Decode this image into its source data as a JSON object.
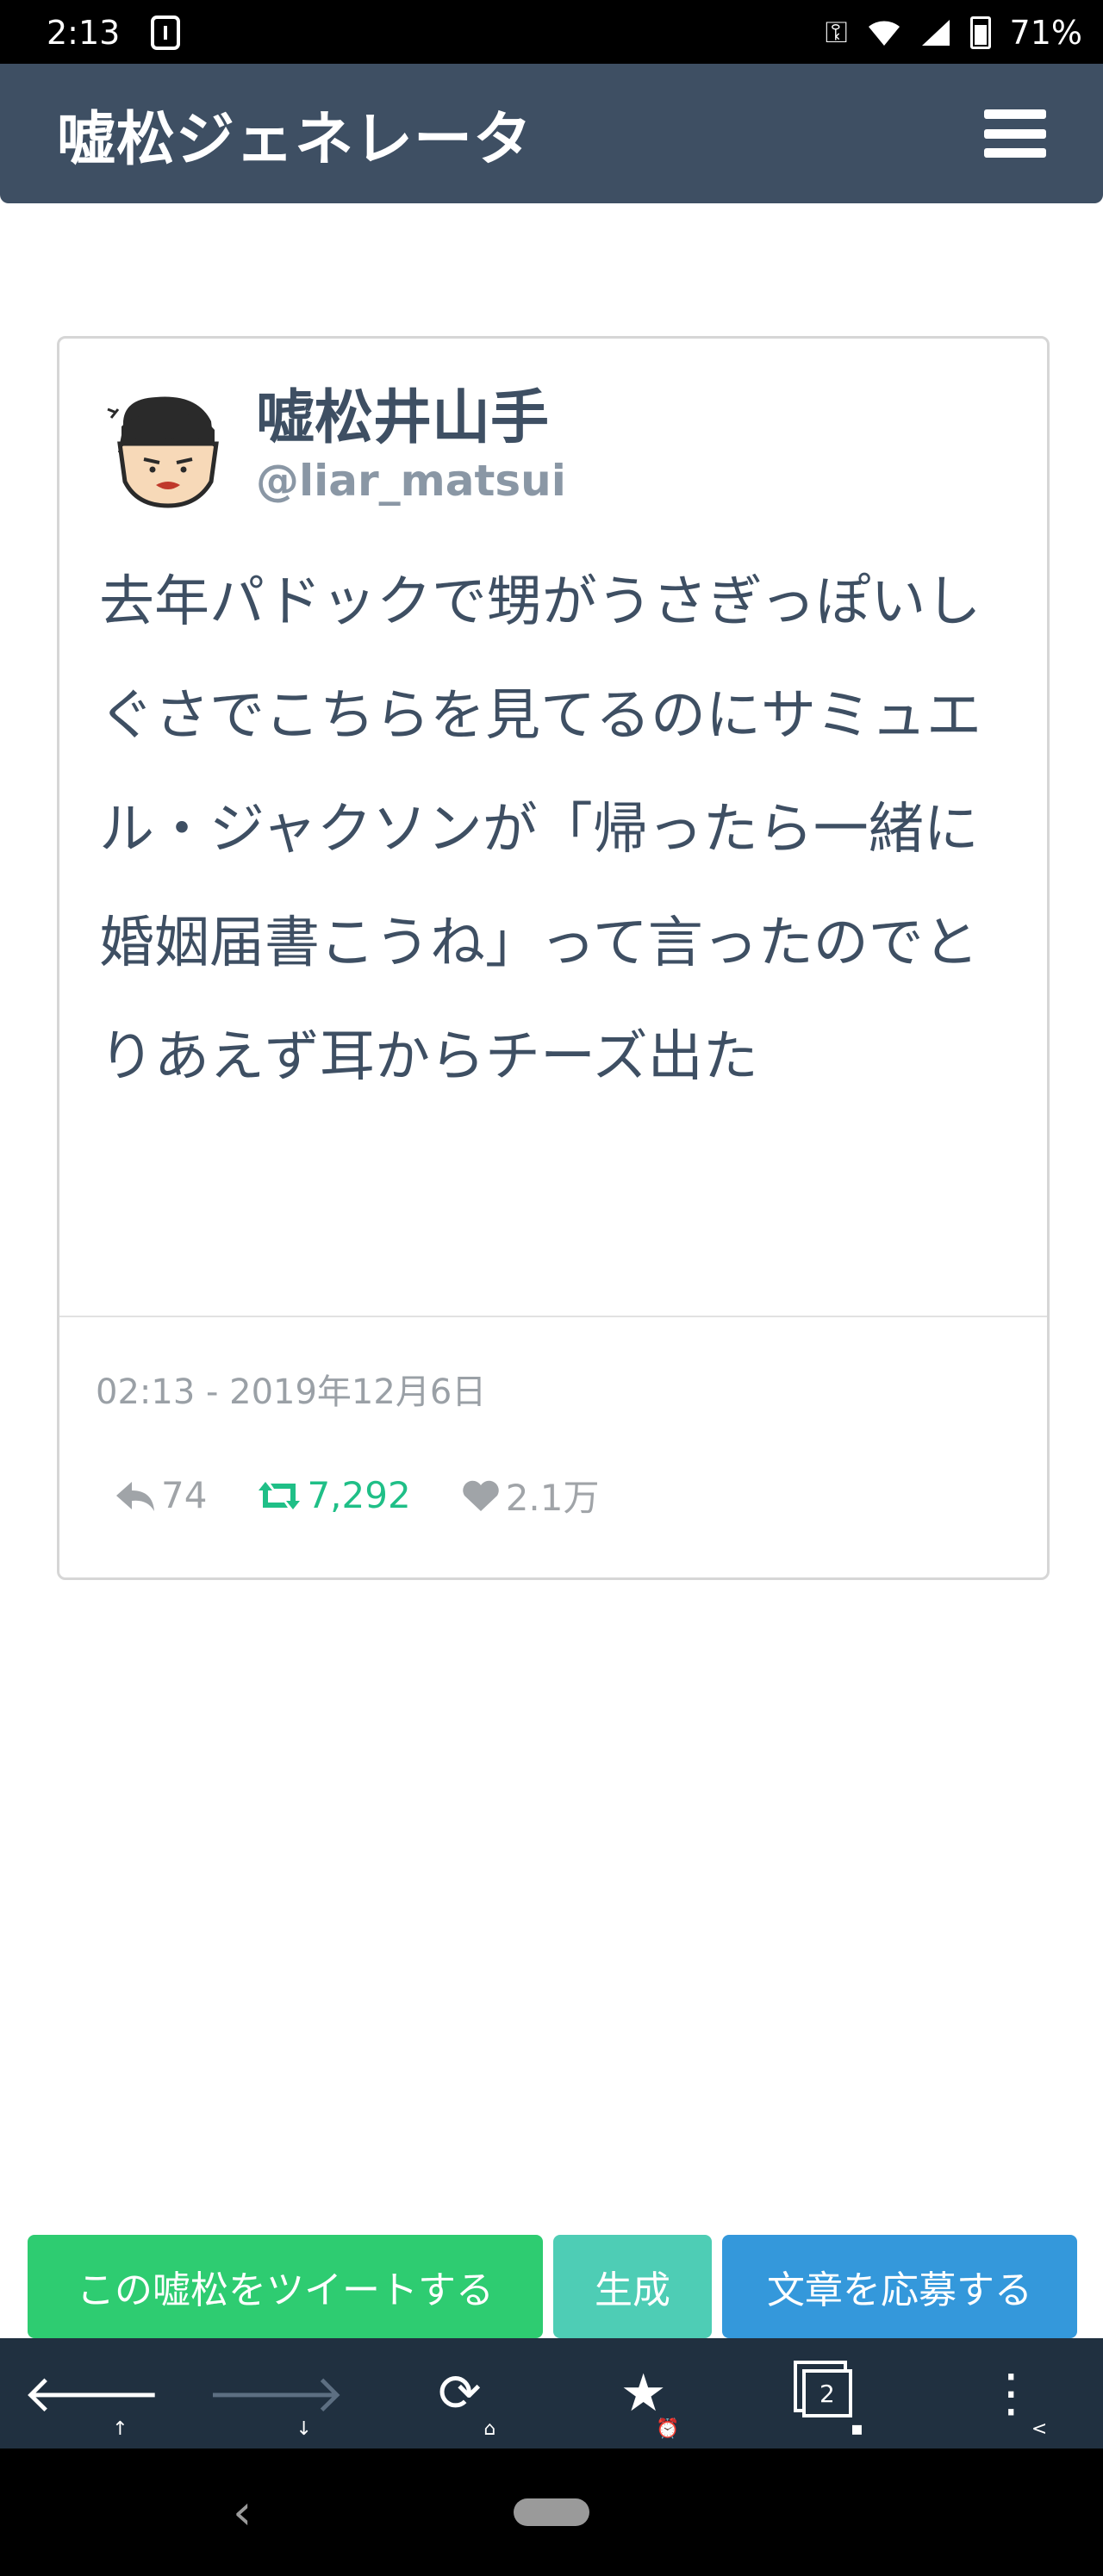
{
  "status_bar": {
    "time": "2:13",
    "battery": "71%"
  },
  "app_bar": {
    "title": "嘘松ジェネレータ"
  },
  "tweet": {
    "display_name": "嘘松井山手",
    "handle": "@liar_matsui",
    "text": "去年パドックで甥がうさぎっぽいしぐさでこちらを見てるのにサミュエル・ジャクソンが「帰ったら一緒に婚姻届書こうね」って言ったのでとりあえず耳からチーズ出た",
    "timestamp": "02:13 - 2019年12月6日",
    "replies": "74",
    "retweets": "7,292",
    "likes": "2.1万"
  },
  "actions": {
    "tweet_label": "この嘘松をツイートする",
    "generate_label": "生成",
    "submit_label": "文章を応募する"
  },
  "browser_toolbar": {
    "tab_count": "2"
  },
  "colors": {
    "header_bg": "#3e4f63",
    "tweet_button": "#2ecc71",
    "generate_button": "#4ecdb5",
    "submit_button": "#3498db",
    "retweet": "#1fbf87",
    "toolbar_bg": "#203040"
  }
}
